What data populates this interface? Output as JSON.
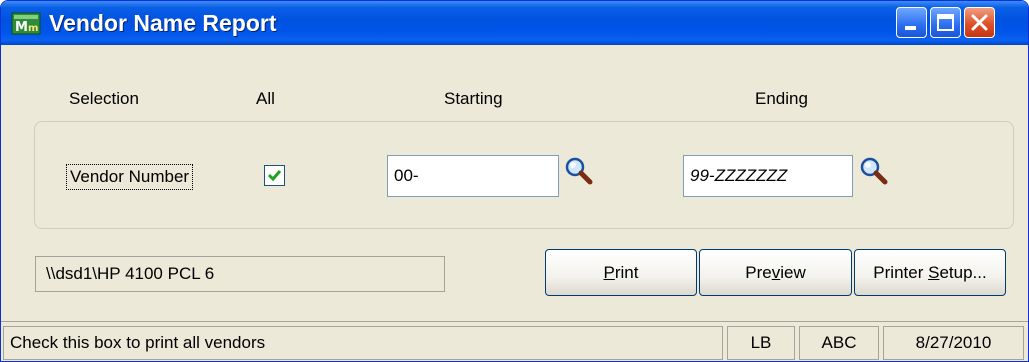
{
  "window": {
    "title": "Vendor Name Report",
    "icon": "sage-mas-app-icon",
    "controls": [
      "minimize-icon",
      "maximize-icon",
      "close-icon"
    ]
  },
  "columns": {
    "selection": "Selection",
    "all": "All",
    "starting": "Starting",
    "ending": "Ending"
  },
  "row": {
    "label": "Vendor Number",
    "all_checked": true,
    "starting_value": "00-",
    "ending_value": "99-ZZZZZZZ",
    "lookup_icon": "magnifier-icon"
  },
  "printer": {
    "name": "\\\\dsd1\\HP 4100 PCL 6"
  },
  "buttons": {
    "print": "Print",
    "print_mnemonic": "P",
    "preview_pre": "Pre",
    "preview_mnemonic": "v",
    "preview_post": "iew",
    "setup_pre": "Printer ",
    "setup_mnemonic": "S",
    "setup_post": "etup..."
  },
  "status": {
    "message": "Check this box to print all vendors",
    "user": "LB",
    "company": "ABC",
    "date": "8/27/2010"
  }
}
